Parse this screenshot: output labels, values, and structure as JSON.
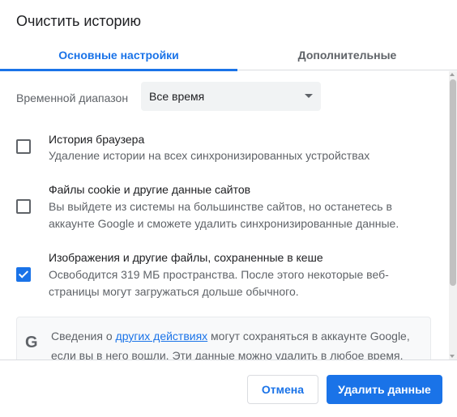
{
  "dialog": {
    "title": "Очистить историю"
  },
  "tabs": [
    {
      "label": "Основные настройки",
      "active": true
    },
    {
      "label": "Дополнительные",
      "active": false
    }
  ],
  "time_range": {
    "label": "Временной диапазон",
    "selected": "Все время"
  },
  "options": [
    {
      "title": "История браузера",
      "description": "Удаление истории на всех синхронизированных устройствах",
      "checked": false
    },
    {
      "title": "Файлы cookie и другие данные сайтов",
      "description": "Вы выйдете из системы на большинстве сайтов, но останетесь в аккаунте Google и сможете удалить синхронизированные данные.",
      "checked": false
    },
    {
      "title": "Изображения и другие файлы, сохраненные в кеше",
      "description": "Освободится 319 МБ пространства. После этого некоторые веб-страницы могут загружаться дольше обычного.",
      "checked": true
    }
  ],
  "info": {
    "icon": "google-g-icon",
    "text_before": "Сведения о ",
    "link": "других действиях",
    "text_after": " могут сохраняться в аккаунте Google, если вы в него вошли. Эти данные можно удалить в любое время."
  },
  "buttons": {
    "cancel": "Отмена",
    "delete": "Удалить данные"
  },
  "colors": {
    "accent": "#1a73e8",
    "text": "#202124",
    "secondary_text": "#5f6368"
  }
}
